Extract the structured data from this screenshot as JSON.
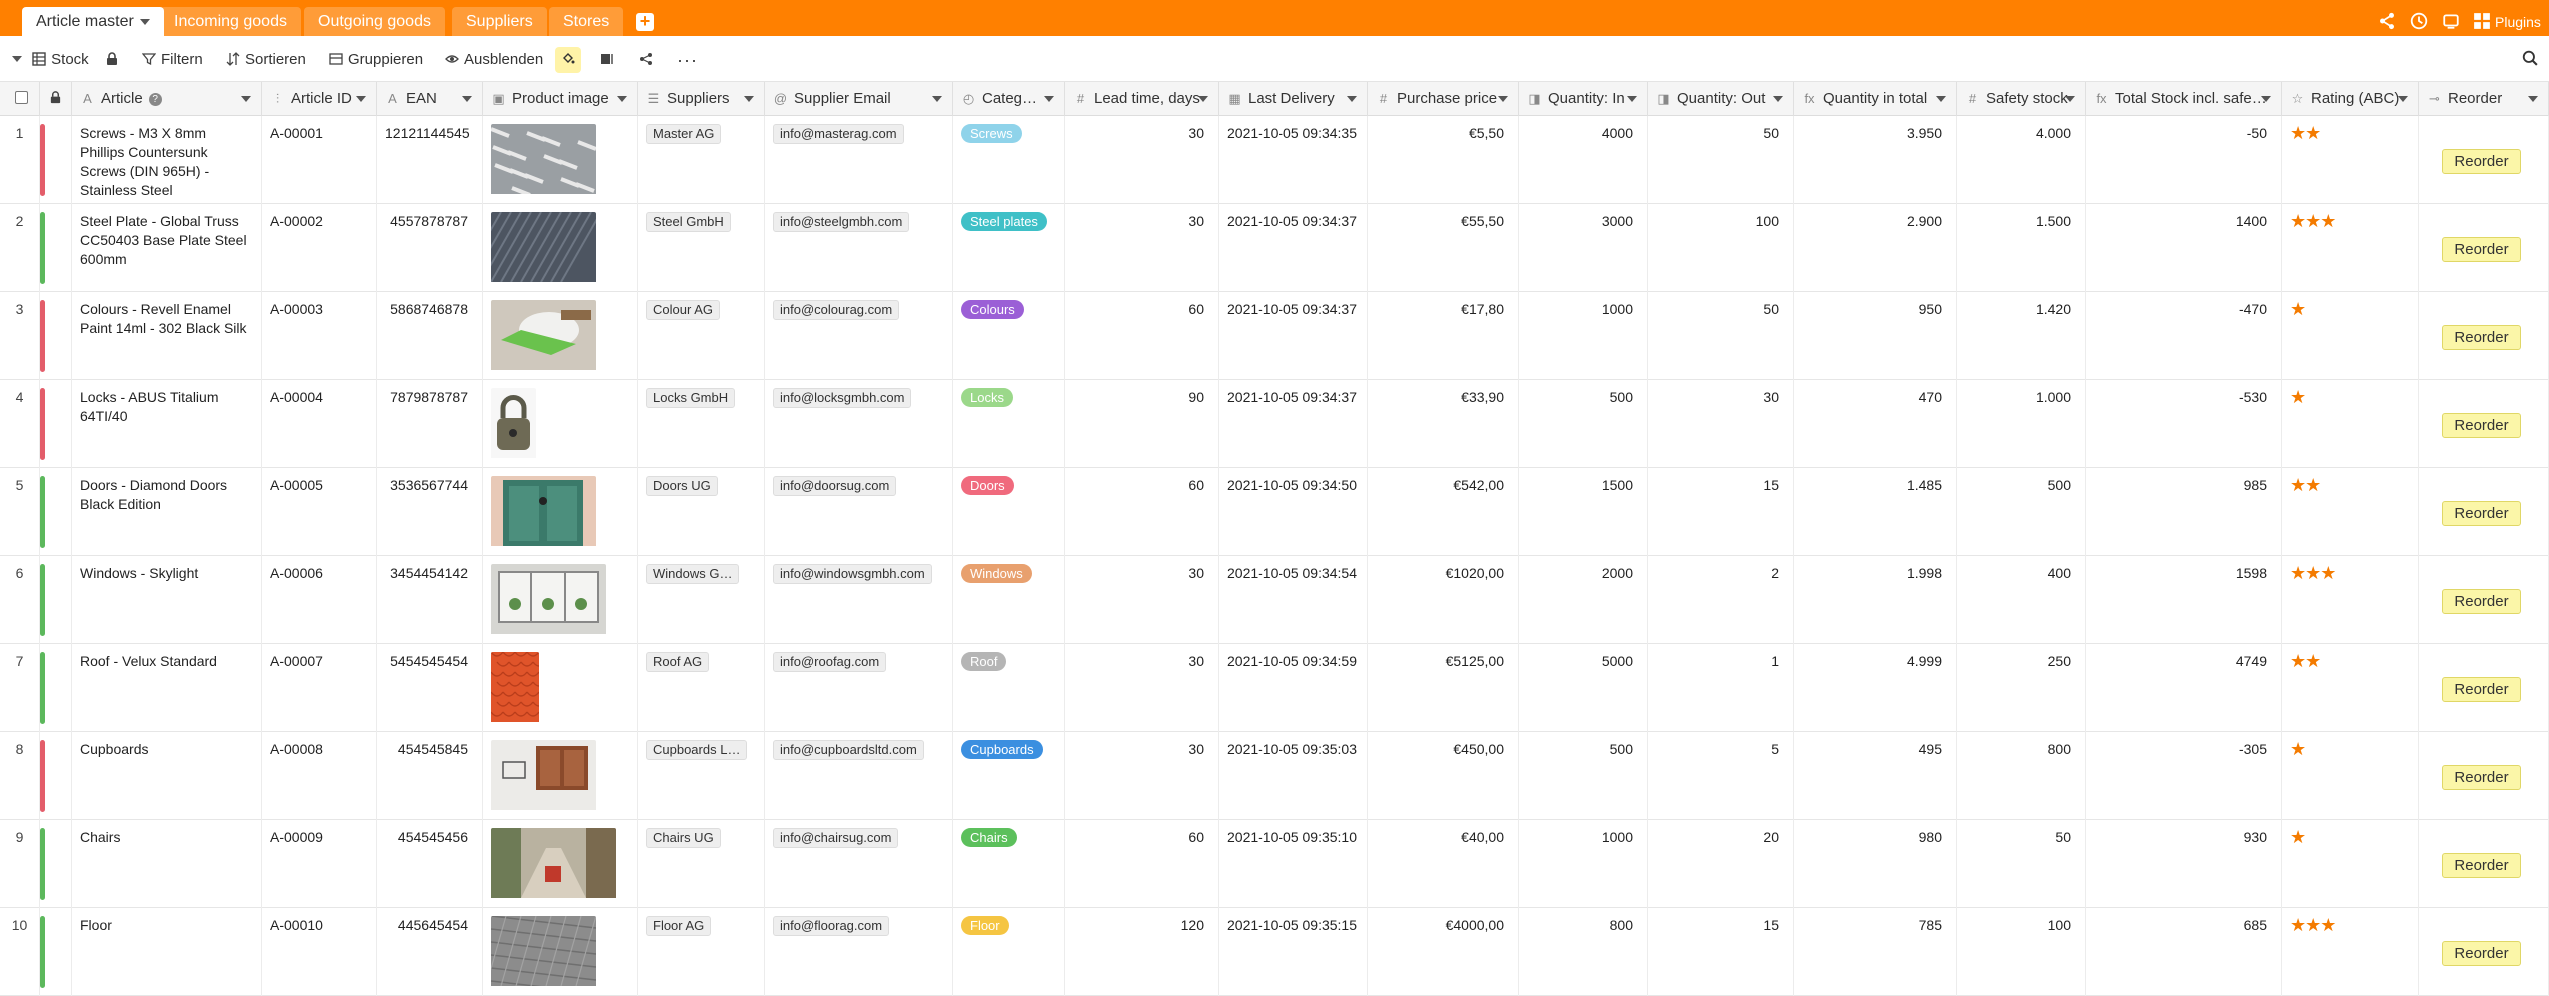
{
  "tabs": [
    {
      "label": "Article master",
      "active": true
    },
    {
      "label": "Incoming goods",
      "active": false
    },
    {
      "label": "Outgoing goods",
      "active": false
    },
    {
      "label": "Suppliers",
      "active": false
    },
    {
      "label": "Stores",
      "active": false
    }
  ],
  "header_right": {
    "plugins_label": "Plugins"
  },
  "toolbar": {
    "view_label": "Stock",
    "filter_label": "Filtern",
    "sort_label": "Sortieren",
    "group_label": "Gruppieren",
    "hide_label": "Ausblenden"
  },
  "columns": [
    {
      "label": "Article",
      "icon": "A"
    },
    {
      "label": "Article ID",
      "icon": "⫶"
    },
    {
      "label": "EAN",
      "icon": "A"
    },
    {
      "label": "Product image",
      "icon": "▣"
    },
    {
      "label": "Suppliers",
      "icon": "☰"
    },
    {
      "label": "Supplier Email",
      "icon": "@"
    },
    {
      "label": "Categ…",
      "icon": "◴"
    },
    {
      "label": "Lead time, days",
      "icon": "#"
    },
    {
      "label": "Last Delivery",
      "icon": "▦"
    },
    {
      "label": "Purchase price",
      "icon": "#"
    },
    {
      "label": "Quantity: In",
      "icon": "◨"
    },
    {
      "label": "Quantity: Out",
      "icon": "◨"
    },
    {
      "label": "Quantity in total",
      "icon": "fx"
    },
    {
      "label": "Safety stock",
      "icon": "#"
    },
    {
      "label": "Total Stock incl. safe…",
      "icon": "fx"
    },
    {
      "label": "Rating (ABC)",
      "icon": "☆"
    },
    {
      "label": "Reorder",
      "icon": "⊸"
    }
  ],
  "colors": {
    "accent": "#ff8000",
    "status_red": "#e35d6a",
    "status_green": "#5cb85c",
    "star": "#f47b00",
    "button_yellow": "#fbf6a8"
  },
  "rows": [
    {
      "num": "1",
      "status": "red",
      "article": "Screws - M3 X 8mm Phillips Countersunk Screws (DIN 965H) - Stainless Steel",
      "id": "A-00001",
      "ean": "12121144545",
      "image": "screws",
      "supplier": "Master AG",
      "email": "info@masterag.com",
      "category": "Screws",
      "cat_color": "#8fd3ea",
      "lead": "30",
      "last": "2021-10-05 09:34:35",
      "price": "€5,50",
      "qin": "4000",
      "qout": "50",
      "qtotal": "3.950",
      "safety": "4.000",
      "stock": "-50",
      "stars": "★★",
      "reorder": "Reorder"
    },
    {
      "num": "2",
      "status": "green",
      "article": "Steel Plate - Global Truss CC50403 Base Plate Steel 600mm",
      "id": "A-00002",
      "ean": "4557878787",
      "image": "steel",
      "supplier": "Steel GmbH",
      "email": "info@steelgmbh.com",
      "category": "Steel plates",
      "cat_color": "#3fc0c7",
      "lead": "30",
      "last": "2021-10-05 09:34:37",
      "price": "€55,50",
      "qin": "3000",
      "qout": "100",
      "qtotal": "2.900",
      "safety": "1.500",
      "stock": "1400",
      "stars": "★★★",
      "reorder": "Reorder"
    },
    {
      "num": "3",
      "status": "red",
      "article": "Colours - Revell Enamel Paint 14ml - 302 Black Silk",
      "id": "A-00003",
      "ean": "5868746878",
      "image": "colours",
      "supplier": "Colour AG",
      "email": "info@colourag.com",
      "category": "Colours",
      "cat_color": "#9b5fd6",
      "lead": "60",
      "last": "2021-10-05 09:34:37",
      "price": "€17,80",
      "qin": "1000",
      "qout": "50",
      "qtotal": "950",
      "safety": "1.420",
      "stock": "-470",
      "stars": "★",
      "reorder": "Reorder"
    },
    {
      "num": "4",
      "status": "red",
      "article": "Locks - ABUS Titalium 64TI/40",
      "id": "A-00004",
      "ean": "7879878787",
      "image": "lock",
      "supplier": "Locks GmbH",
      "email": "info@locksgmbh.com",
      "category": "Locks",
      "cat_color": "#9bd88a",
      "lead": "90",
      "last": "2021-10-05 09:34:37",
      "price": "€33,90",
      "qin": "500",
      "qout": "30",
      "qtotal": "470",
      "safety": "1.000",
      "stock": "-530",
      "stars": "★",
      "reorder": "Reorder"
    },
    {
      "num": "5",
      "status": "green",
      "article": "Doors - Diamond Doors Black Edition",
      "id": "A-00005",
      "ean": "3536567744",
      "image": "door",
      "supplier": "Doors UG",
      "email": "info@doorsug.com",
      "category": "Doors",
      "cat_color": "#f06a7d",
      "lead": "60",
      "last": "2021-10-05 09:34:50",
      "price": "€542,00",
      "qin": "1500",
      "qout": "15",
      "qtotal": "1.485",
      "safety": "500",
      "stock": "985",
      "stars": "★★",
      "reorder": "Reorder"
    },
    {
      "num": "6",
      "status": "green",
      "article": "Windows - Skylight",
      "id": "A-00006",
      "ean": "3454454142",
      "image": "window",
      "supplier": "Windows G…",
      "email": "info@windowsgmbh.com",
      "category": "Windows",
      "cat_color": "#e8a06e",
      "lead": "30",
      "last": "2021-10-05 09:34:54",
      "price": "€1020,00",
      "qin": "2000",
      "qout": "2",
      "qtotal": "1.998",
      "safety": "400",
      "stock": "1598",
      "stars": "★★★",
      "reorder": "Reorder"
    },
    {
      "num": "7",
      "status": "green",
      "article": "Roof - Velux Standard",
      "id": "A-00007",
      "ean": "5454545454",
      "image": "roof",
      "supplier": "Roof AG",
      "email": "info@roofag.com",
      "category": "Roof",
      "cat_color": "#b5b5b5",
      "lead": "30",
      "last": "2021-10-05 09:34:59",
      "price": "€5125,00",
      "qin": "5000",
      "qout": "1",
      "qtotal": "4.999",
      "safety": "250",
      "stock": "4749",
      "stars": "★★",
      "reorder": "Reorder"
    },
    {
      "num": "8",
      "status": "red",
      "article": "Cupboards",
      "id": "A-00008",
      "ean": "454545845",
      "image": "cupboard",
      "supplier": "Cupboards L…",
      "email": "info@cupboardsltd.com",
      "category": "Cupboards",
      "cat_color": "#3b8fe0",
      "lead": "30",
      "last": "2021-10-05 09:35:03",
      "price": "€450,00",
      "qin": "500",
      "qout": "5",
      "qtotal": "495",
      "safety": "800",
      "stock": "-305",
      "stars": "★",
      "reorder": "Reorder"
    },
    {
      "num": "9",
      "status": "green",
      "article": "Chairs",
      "id": "A-00009",
      "ean": "454545456",
      "image": "chair",
      "supplier": "Chairs UG",
      "email": "info@chairsug.com",
      "category": "Chairs",
      "cat_color": "#5cc05c",
      "lead": "60",
      "last": "2021-10-05 09:35:10",
      "price": "€40,00",
      "qin": "1000",
      "qout": "20",
      "qtotal": "980",
      "safety": "50",
      "stock": "930",
      "stars": "★",
      "reorder": "Reorder"
    },
    {
      "num": "10",
      "status": "green",
      "article": "Floor",
      "id": "A-00010",
      "ean": "445645454",
      "image": "floor",
      "supplier": "Floor AG",
      "email": "info@floorag.com",
      "category": "Floor",
      "cat_color": "#f5c542",
      "lead": "120",
      "last": "2021-10-05 09:35:15",
      "price": "€4000,00",
      "qin": "800",
      "qout": "15",
      "qtotal": "785",
      "safety": "100",
      "stock": "685",
      "stars": "★★★",
      "reorder": "Reorder"
    }
  ]
}
